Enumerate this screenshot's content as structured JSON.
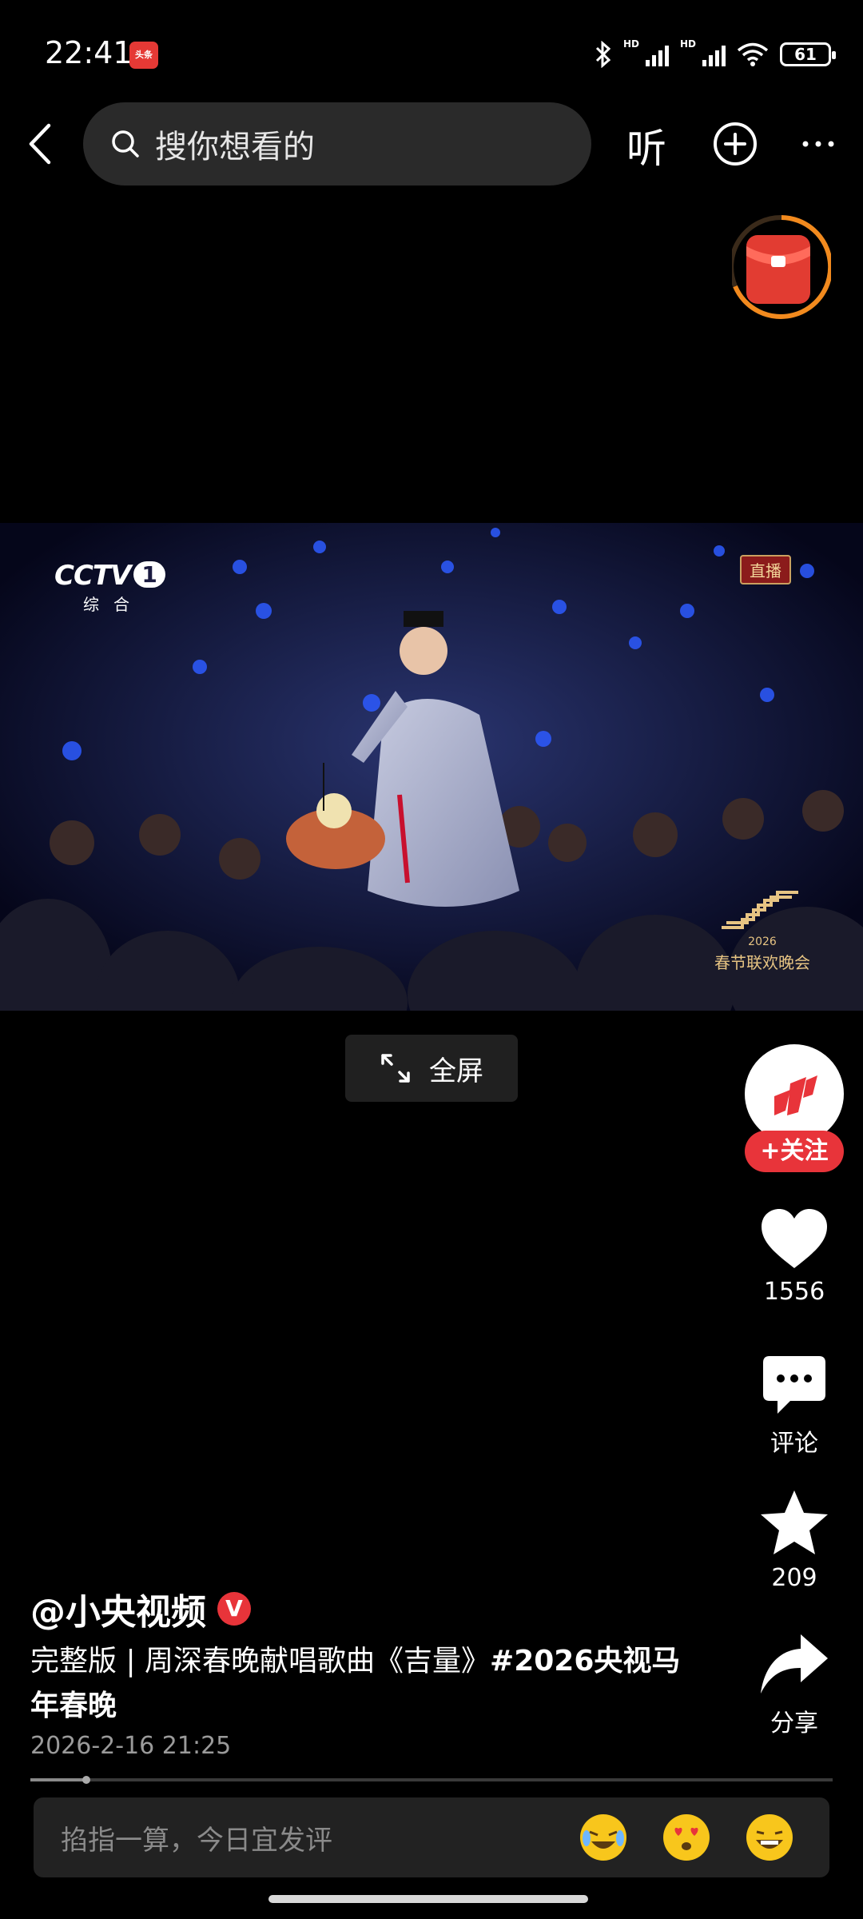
{
  "status_bar": {
    "time": "22:41",
    "app_badge": "头条",
    "network_labels": [
      "HD",
      "HD"
    ],
    "battery": "61"
  },
  "top_nav": {
    "search_placeholder": "搜你想看的",
    "listen_label": "听",
    "icons": [
      "back-arrow-icon",
      "search-icon",
      "add-circle-icon",
      "more-icon"
    ]
  },
  "video": {
    "channel_brand": "CCTV",
    "channel_number": "1",
    "channel_sub": "综合",
    "live_badge": "直播",
    "gala_year": "2026",
    "gala_title": "春节联欢晚会",
    "fullscreen_label": "全屏"
  },
  "actions": {
    "follow_label": "+关注",
    "likes": "1556",
    "comments_label": "评论",
    "favorites": "209",
    "share_label": "分享"
  },
  "post": {
    "author": "@小央视频",
    "verified_mark": "V",
    "caption": "完整版 | 周深春晚献唱歌曲《吉量》",
    "hashtag": "#2026央视马年春晚",
    "publish_time": "2026-2-16 21:25",
    "progress": 0.07
  },
  "comment_bar": {
    "placeholder": "掐指一算，今日宜发评"
  },
  "colors": {
    "accent_red": "#e8343a",
    "background": "#000000"
  }
}
